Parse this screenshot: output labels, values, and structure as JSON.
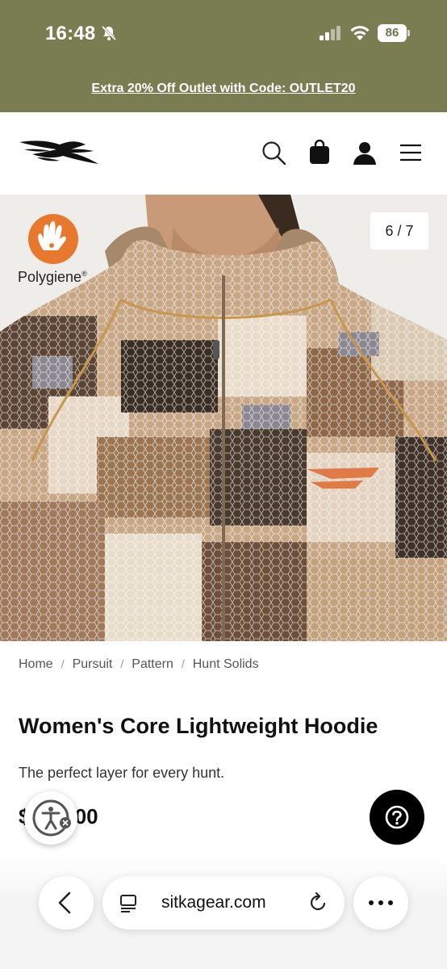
{
  "status_bar": {
    "time": "16:48",
    "battery": "86",
    "icons": [
      "bell-off-icon",
      "signal-icon",
      "wifi-icon",
      "battery-icon"
    ]
  },
  "promo_banner": {
    "text": "Extra 20% Off Outlet with Code: OUTLET20"
  },
  "header": {
    "icons": [
      "sitka-logo",
      "search-icon",
      "bag-icon",
      "account-icon",
      "menu-icon"
    ]
  },
  "hero": {
    "counter": "6 / 7",
    "badge_text": "Polygiene",
    "badge_mark": "®"
  },
  "breadcrumb": [
    "Home",
    "Pursuit",
    "Pattern",
    "Hunt Solids"
  ],
  "product": {
    "title": "Women's Core Lightweight Hoodie",
    "subtitle": "The perfect layer for every hunt.",
    "price_visible": "$",
    "price_tail": ".00"
  },
  "browser": {
    "url": "sitkagear.com"
  },
  "colors": {
    "banner_bg": "#7a7c52",
    "poly_orange": "#e8782e"
  }
}
